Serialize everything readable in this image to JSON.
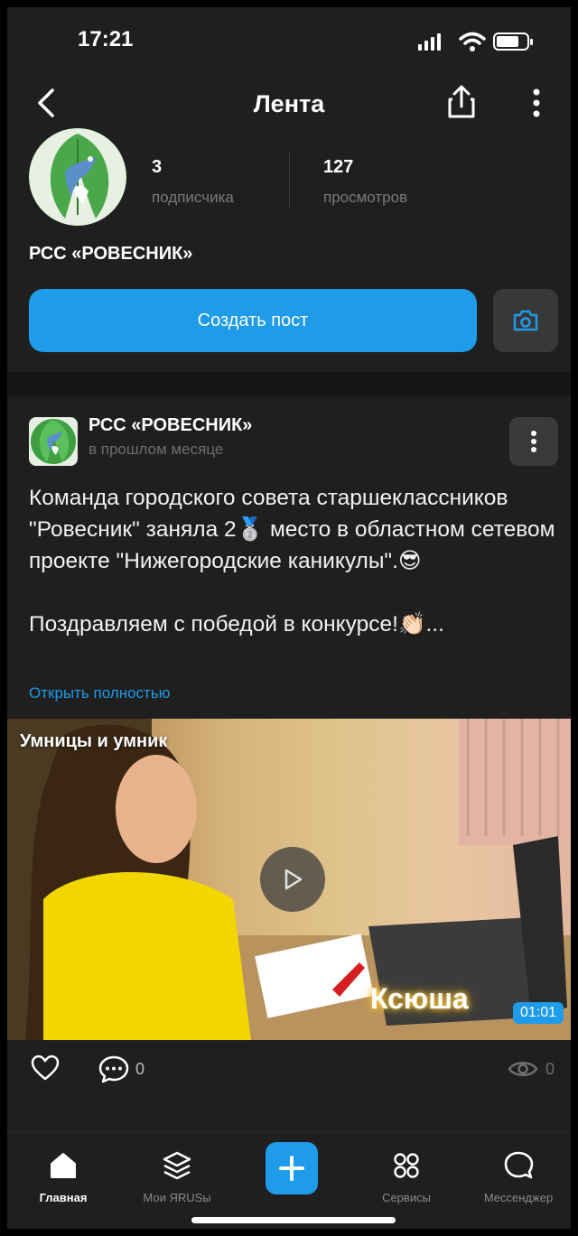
{
  "status_bar": {
    "time": "17:21"
  },
  "nav": {
    "title": "Лента"
  },
  "profile": {
    "subscribers_count": "3",
    "subscribers_label": "подписчика",
    "views_count": "127",
    "views_label": "просмотров",
    "name": "РСС «РОВЕСНИК»",
    "create_post_label": "Создать пост"
  },
  "post": {
    "author": "РСС «РОВЕСНИК»",
    "time": "в прошлом месяце",
    "text": "Команда городского совета старшеклассников \"Ровесник\" заняла 2🥈 место в областном сетевом проекте \"Нижегородские каникулы\".😎\n\nПоздравляем с победой в конкурсе!👏🏻...",
    "expand_label": "Открыть полностью",
    "media": {
      "caption": "Умницы и умник",
      "name_tag": "Ксюша",
      "duration": "01:01"
    },
    "comments_count": "0",
    "views_count": "0"
  },
  "tabbar": {
    "items": [
      {
        "label": "Главная",
        "icon": "home-icon",
        "active": true
      },
      {
        "label": "Мои ЯRUSы",
        "icon": "layers-icon",
        "active": false
      },
      {
        "label": "",
        "icon": "plus-icon",
        "active": false
      },
      {
        "label": "Сервисы",
        "icon": "grid-icon",
        "active": false
      },
      {
        "label": "Мессенджер",
        "icon": "chat-icon",
        "active": false
      }
    ]
  },
  "colors": {
    "accent": "#1e9be9",
    "background": "#1f1f1f",
    "muted_text": "#7a7a7a"
  }
}
